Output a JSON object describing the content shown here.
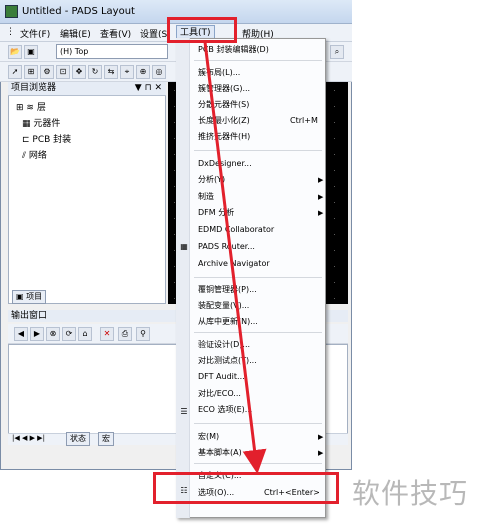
{
  "window": {
    "title": "Untitled - PADS Layout"
  },
  "menubar": {
    "items": [
      "文件(F)",
      "编辑(E)",
      "查看(V)",
      "设置(S)",
      "工具(T)",
      "帮助(H)"
    ],
    "active_index": 4
  },
  "toolbar": {
    "layer_combo": "(H) Top"
  },
  "project_browser": {
    "title": "项目浏览器",
    "title_controls": "▼ ⊓ ✕",
    "items": [
      "层",
      "元器件",
      "PCB 封装",
      "网络"
    ],
    "tab_label": "项目"
  },
  "output_window": {
    "title": "输出窗口",
    "tabs": [
      "状态",
      "宏"
    ]
  },
  "tools_menu": {
    "items": [
      {
        "label": "PCB 封装编辑器(D)",
        "shortcut": "",
        "submenu": false
      },
      {
        "label": "簇布局(L)...",
        "shortcut": "",
        "submenu": false
      },
      {
        "label": "簇管理器(G)...",
        "shortcut": "",
        "submenu": false
      },
      {
        "label": "分散元器件(S)",
        "shortcut": "",
        "submenu": false
      },
      {
        "label": "长度最小化(Z)",
        "shortcut": "Ctrl+M",
        "submenu": false
      },
      {
        "label": "推挤元器件(H)",
        "shortcut": "",
        "submenu": false
      },
      {
        "label": "DxDesigner...",
        "shortcut": "",
        "submenu": false
      },
      {
        "label": "分析(Y)",
        "shortcut": "",
        "submenu": true
      },
      {
        "label": "制造",
        "shortcut": "",
        "submenu": true
      },
      {
        "label": "DFM 分析",
        "shortcut": "",
        "submenu": true
      },
      {
        "label": "EDMD Collaborator",
        "shortcut": "",
        "submenu": false
      },
      {
        "label": "PADS Router...",
        "shortcut": "",
        "submenu": false
      },
      {
        "label": "Archive Navigator",
        "shortcut": "",
        "submenu": false
      },
      {
        "label": "覆铜管理器(P)...",
        "shortcut": "",
        "submenu": false
      },
      {
        "label": "装配变量(V)...",
        "shortcut": "",
        "submenu": false
      },
      {
        "label": "从库中更新(N)...",
        "shortcut": "",
        "submenu": false
      },
      {
        "label": "验证设计(D)...",
        "shortcut": "",
        "submenu": false
      },
      {
        "label": "对比测试点(T)...",
        "shortcut": "",
        "submenu": false
      },
      {
        "label": "DFT Audit...",
        "shortcut": "",
        "submenu": false
      },
      {
        "label": "对比/ECO...",
        "shortcut": "",
        "submenu": false
      },
      {
        "label": "ECO 选项(E)...",
        "shortcut": "",
        "submenu": false
      },
      {
        "label": "宏(M)",
        "shortcut": "",
        "submenu": true
      },
      {
        "label": "基本脚本(A)",
        "shortcut": "",
        "submenu": true
      },
      {
        "label": "自定义(C)...",
        "shortcut": "",
        "submenu": false
      },
      {
        "label": "选项(O)...",
        "shortcut": "Ctrl+<Enter>",
        "submenu": false
      }
    ]
  },
  "watermark": "软件技巧",
  "colors": {
    "highlight": "#e2202c",
    "canvas": "#000000"
  }
}
